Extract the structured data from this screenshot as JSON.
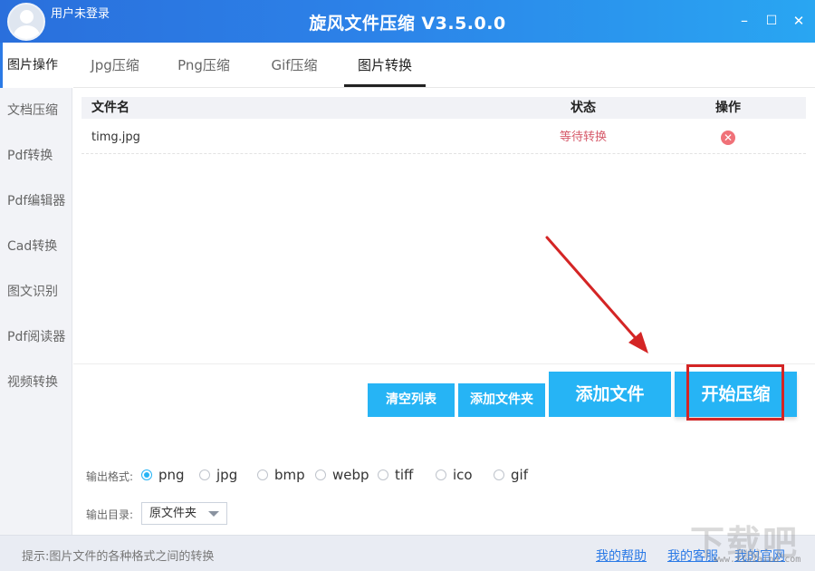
{
  "app": {
    "title": "旋风文件压缩 V3.5.0.0",
    "user_label": "用户未登录",
    "window_buttons": {
      "minimize": "–",
      "maximize": "☐",
      "close": "✕"
    }
  },
  "sidebar": {
    "items": [
      {
        "label": "图片操作",
        "active": true
      },
      {
        "label": "文档压缩"
      },
      {
        "label": "Pdf转换"
      },
      {
        "label": "Pdf编辑器"
      },
      {
        "label": "Cad转换"
      },
      {
        "label": "图文识别"
      },
      {
        "label": "Pdf阅读器"
      },
      {
        "label": "视频转换"
      }
    ]
  },
  "tabs": [
    {
      "label": "Jpg压缩"
    },
    {
      "label": "Png压缩"
    },
    {
      "label": "Gif压缩"
    },
    {
      "label": "图片转换",
      "active": true
    }
  ],
  "table": {
    "headers": {
      "name": "文件名",
      "status": "状态",
      "action": "操作"
    },
    "rows": [
      {
        "name": "timg.jpg",
        "status": "等待转换",
        "action_icon": "delete-icon"
      }
    ]
  },
  "buttons": {
    "clear_list": "清空列表",
    "add_folder": "添加文件夹",
    "add_file": "添加文件",
    "start": "开始压缩"
  },
  "options": {
    "format_label": "输出格式:",
    "formats": [
      "png",
      "jpg",
      "bmp",
      "webp",
      "tiff",
      "ico",
      "gif"
    ],
    "selected_format": "png",
    "dir_label": "输出目录:",
    "dir_value": "原文件夹"
  },
  "footer": {
    "tip": "提示:图片文件的各种格式之间的转换",
    "links": [
      "我的帮助",
      "我的客服",
      "我的官网"
    ]
  },
  "watermark": {
    "text": "下载吧",
    "url": "www.xiazaiba.com"
  },
  "colors": {
    "titlebar_start": "#2a6fdc",
    "titlebar_end": "#29a6f2",
    "button": "#26b4f5",
    "highlight": "#d42525",
    "status": "#d65a6a",
    "link": "#2b7ae6"
  }
}
